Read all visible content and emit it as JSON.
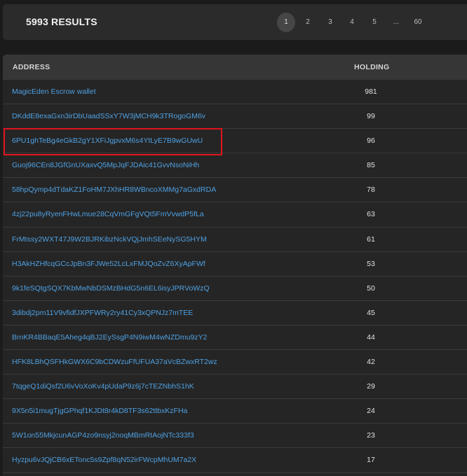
{
  "results": {
    "count_label": "5993 RESULTS"
  },
  "pagination": {
    "pages": [
      "1",
      "2",
      "3",
      "4",
      "5",
      "...",
      "60"
    ],
    "active": "1"
  },
  "table": {
    "headers": {
      "address": "ADDRESS",
      "holding": "HOLDING"
    },
    "rows": [
      {
        "address": "MagicEden Escrow wallet",
        "holding": "981"
      },
      {
        "address": "DKddE8exaGxn3irDbUaadSSxY7W3jMCH9k3TRogoGM6v",
        "holding": "99"
      },
      {
        "address": "6PU1ghTeBg4eGkB2gY1XFiJgpvxM6s4YtLyE7B9wGUwU",
        "holding": "96"
      },
      {
        "address": "Guoj96CEn8JGfGnUXaxvQ5MpJqFJDAic41GvvNsoNiHh",
        "holding": "85"
      },
      {
        "address": "58hpQymp4dTdaKZ1FoHM7JXhHR8WBncoXMMg7aGxdRDA",
        "holding": "78"
      },
      {
        "address": "4zj22pu8yRyenFHwLmue28CqVmGFgVQt5FmVvwdP5fLa",
        "holding": "63"
      },
      {
        "address": "FrMtssy2WXT47J9W2BJRKibzNckVQjJmhSEeNySG5HYM",
        "holding": "61"
      },
      {
        "address": "H3AkHZHfcqGCcJpBn3FJWe52LcLxFMJQoZvZ6XyApFWf",
        "holding": "53"
      },
      {
        "address": "9k1feSQtgSQX7KbMwNbDSMzBHdG5n6EL6isyJPRVoWzQ",
        "holding": "50"
      },
      {
        "address": "3dibdj2pm11V9vfidfJXPFWRy2ry41Cy3xQPNJz7mTEE",
        "holding": "45"
      },
      {
        "address": "BrnKR4BBaqE5Aheg4qBJ2EySsgP4N9iwM4wNZDmu9zY2",
        "holding": "44"
      },
      {
        "address": "HFK8LBhQSFHkGWX6C9bCDWzuFfUFUA37aVcBZwxRT2wz",
        "holding": "42"
      },
      {
        "address": "7tqgeQ1diQsf2U6vVoXoKv4pUdaP9z6j7cTEZNbhS1hK",
        "holding": "29"
      },
      {
        "address": "9X5n5i1mugTjgGPhqf1KJDt8r4kD8TF3s62ttbxKzFHa",
        "holding": "24"
      },
      {
        "address": "5W1on55MkjcunAGP4zo9nsyj2noqMBmRtAojNTc333f3",
        "holding": "23"
      },
      {
        "address": "Hyzpu6vJQjCB6xETonc5s9Zpf8qN52irFWcpMhUM7a2X",
        "holding": "17"
      }
    ]
  },
  "colors": {
    "link": "#4fa1e3",
    "highlight_box": "#e0141e",
    "background": "#1b1b1b"
  }
}
